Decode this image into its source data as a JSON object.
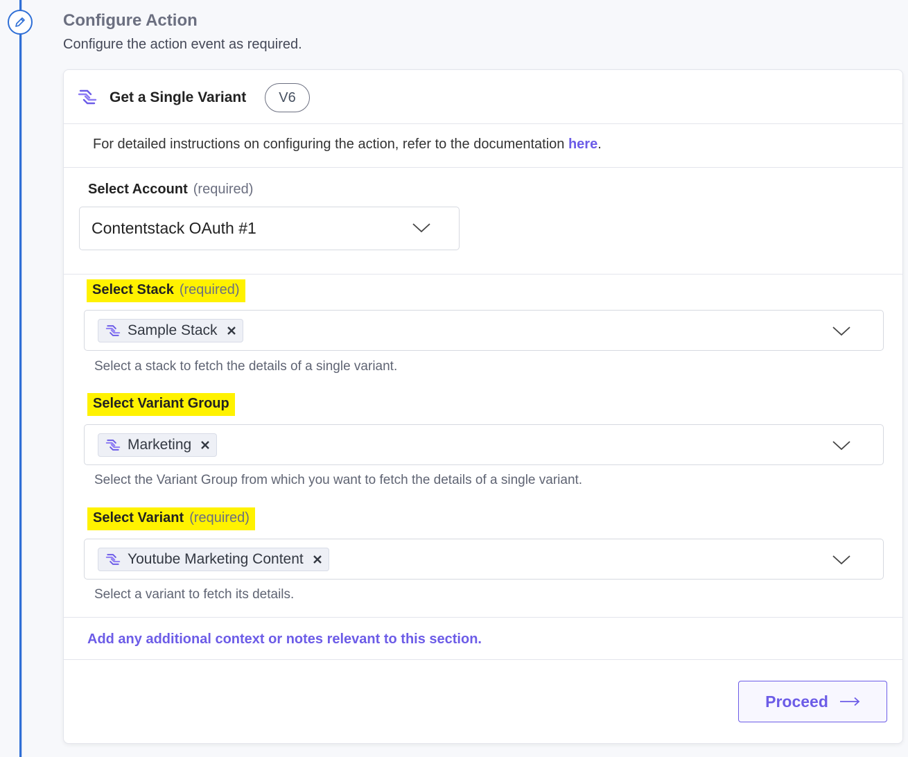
{
  "header": {
    "title": "Configure Action",
    "subtitle": "Configure the action event as required."
  },
  "action": {
    "name": "Get a Single Variant",
    "version": "V6",
    "doc_text": "For detailed instructions on configuring the action, refer to the documentation ",
    "doc_link": "here",
    "doc_suffix": "."
  },
  "account": {
    "label": "Select Account",
    "required": "(required)",
    "value": "Contentstack OAuth #1"
  },
  "stack": {
    "label": "Select Stack",
    "required": "(required)",
    "chip": "Sample Stack",
    "helper": "Select a stack to fetch the details of a single variant."
  },
  "variant_group": {
    "label": "Select Variant Group",
    "chip": "Marketing",
    "helper": "Select the Variant Group from which you want to fetch the details of a single variant."
  },
  "variant": {
    "label": "Select Variant",
    "required": "(required)",
    "chip": "Youtube Marketing Content",
    "helper": "Select a variant to fetch its details."
  },
  "notes": "Add any additional context or notes relevant to this section.",
  "proceed_label": "Proceed",
  "icons": {
    "step": "pencil-icon",
    "app": "contentstack-logo-icon",
    "dropdown": "chevron-down-icon",
    "remove": "close-icon",
    "proceed": "arrow-right-icon"
  },
  "colors": {
    "accent": "#6c5ce7",
    "timeline": "#2f6fd6",
    "highlight": "#fff200"
  }
}
